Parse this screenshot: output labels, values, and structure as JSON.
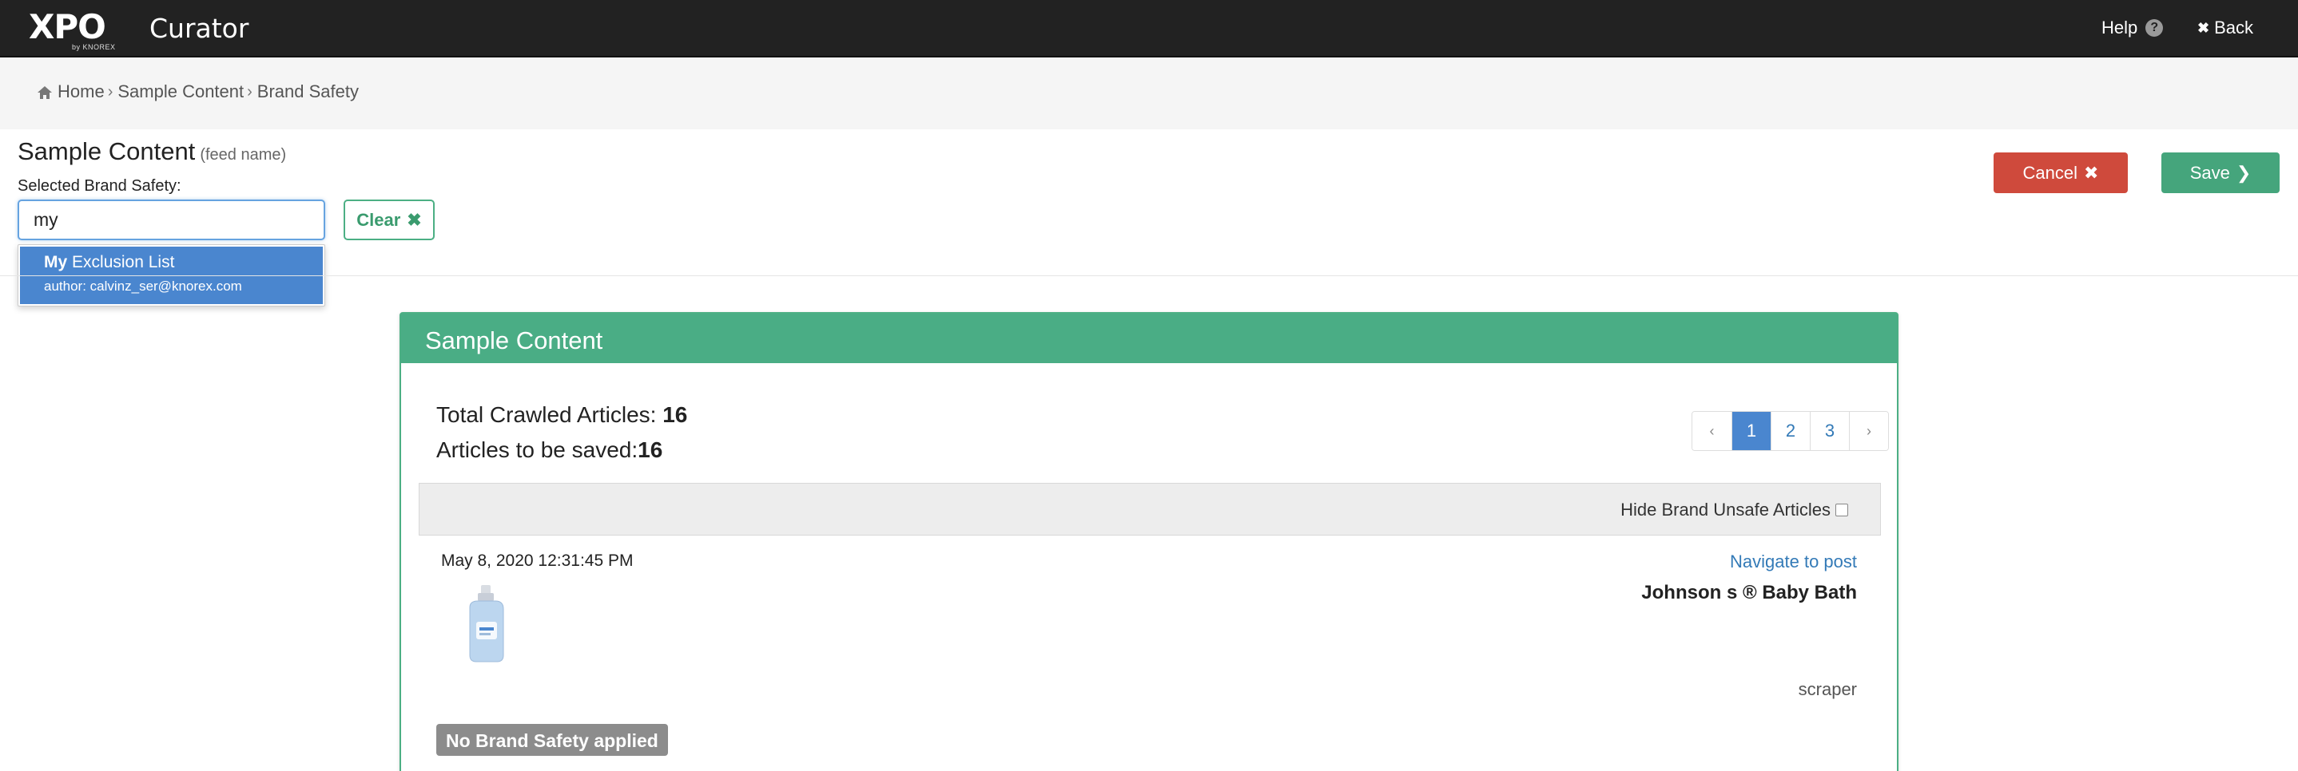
{
  "navbar": {
    "logo_text": "XPO",
    "logo_sub": "by KNOREX",
    "app_name": "Curator",
    "help_label": "Help",
    "help_icon": "question-circle-icon",
    "back_label": "Back",
    "back_icon": "close-icon"
  },
  "breadcrumb": {
    "items": [
      "Home",
      "Sample Content",
      "Brand Safety"
    ],
    "home_icon": "home-icon"
  },
  "form": {
    "title": "Sample Content",
    "title_note": "(feed name)",
    "brand_label": "Selected Brand Safety:",
    "search_value": "my",
    "clear_label": "Clear"
  },
  "dropdown": {
    "item_match": "My",
    "item_rest": " Exclusion List",
    "item_author": "author: calvinz_ser@knorex.com"
  },
  "actions": {
    "cancel_label": "Cancel",
    "save_label": "Save"
  },
  "panel": {
    "title": "Sample Content",
    "total_label": "Total Crawled Articles: ",
    "total_value": "16",
    "saved_label": "Articles to be saved:",
    "saved_value": "16",
    "pagination": {
      "prev": "‹",
      "pages": [
        "1",
        "2",
        "3"
      ],
      "next": "›",
      "current": "1"
    },
    "hide_label": "Hide Brand Unsafe Articles"
  },
  "article": {
    "date": "May 8, 2020 12:31:45 PM",
    "navigate_label": "Navigate to post",
    "title": "Johnson s ® Baby Bath",
    "source": "scraper",
    "badge": "No Brand Safety applied"
  },
  "colors": {
    "navbar": "#222222",
    "accent_green": "#4aad85",
    "cancel_red": "#cf4a3c",
    "link_blue": "#337ab7",
    "highlight_blue": "#4a86cf"
  }
}
